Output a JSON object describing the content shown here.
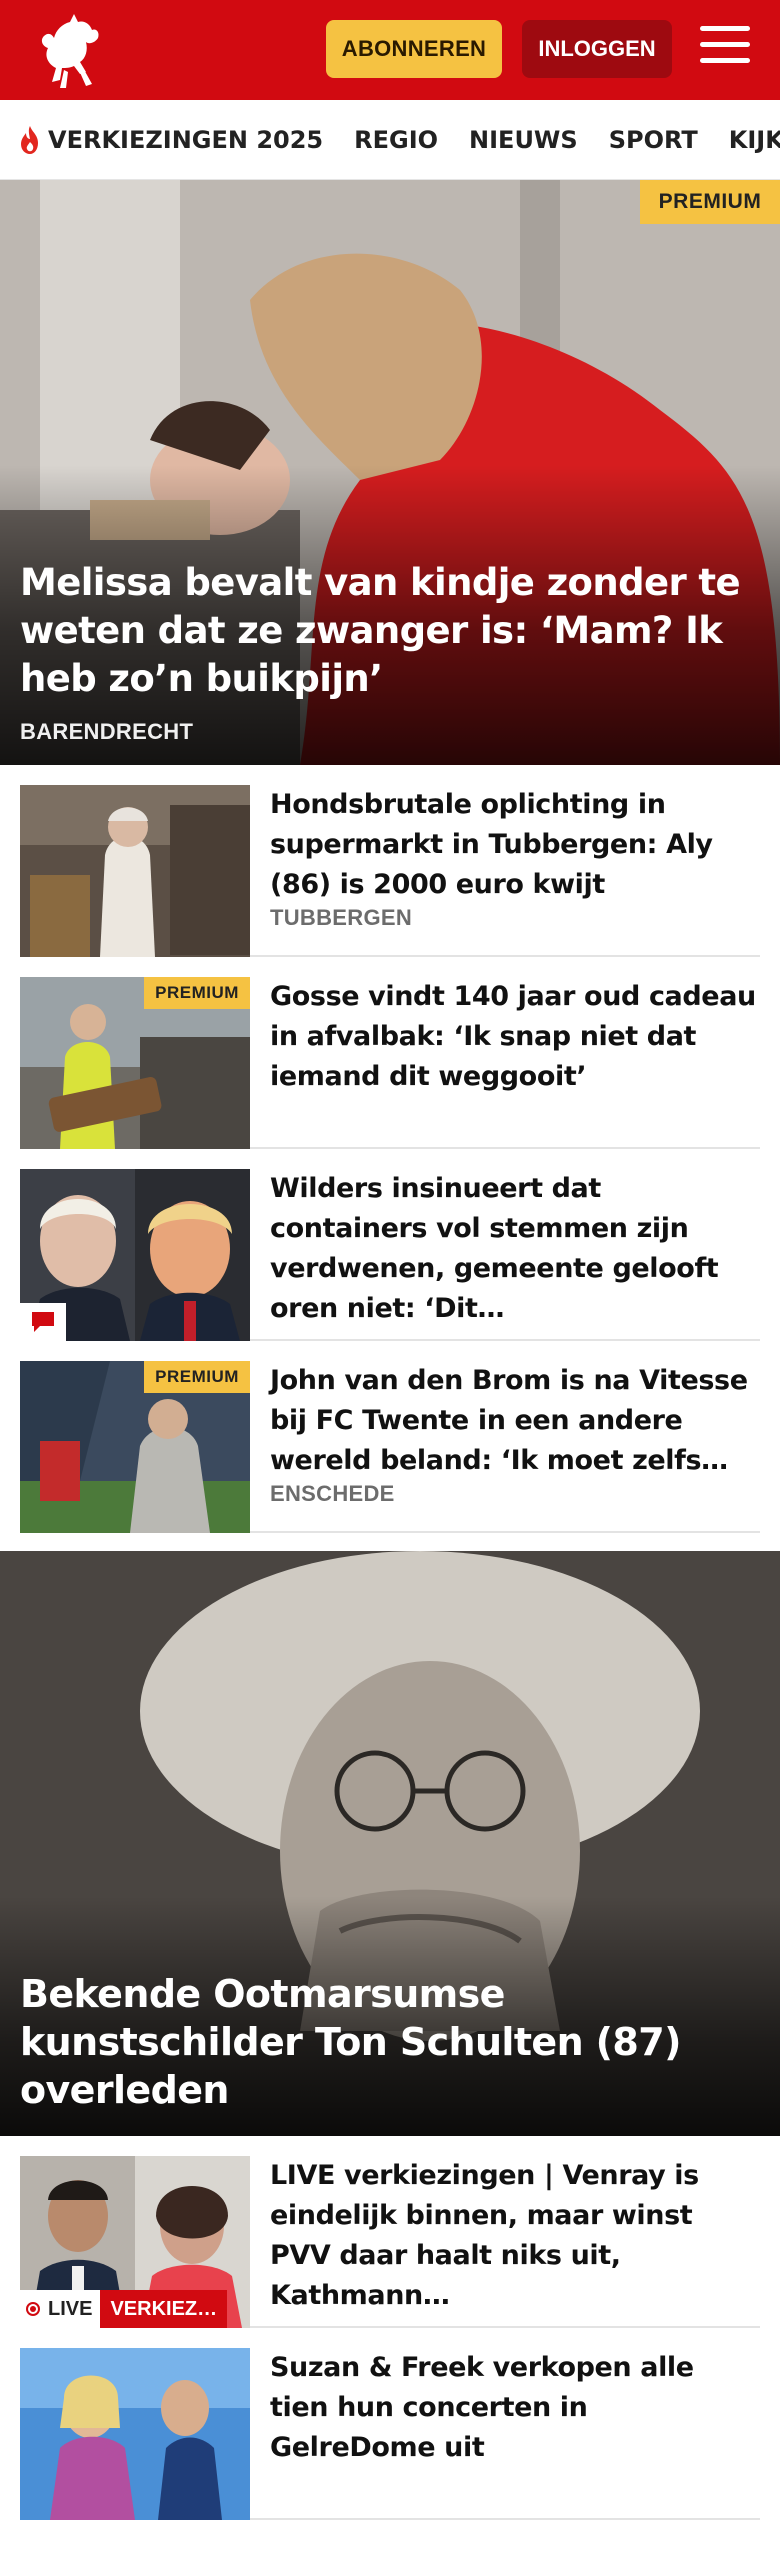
{
  "header": {
    "subscribe_label": "ABONNEREN",
    "login_label": "INLOGGEN"
  },
  "nav": {
    "items": [
      {
        "label": "VERKIEZINGEN 2025",
        "icon": "flame-icon"
      },
      {
        "label": "REGIO"
      },
      {
        "label": "NIEUWS"
      },
      {
        "label": "SPORT"
      },
      {
        "label": "KIJK"
      }
    ]
  },
  "hero": {
    "badge": "PREMIUM",
    "title": "Melissa bevalt van kindje zonder te weten dat ze zwanger is: ‘Mam? Ik heb zo’n buikpijn’",
    "location": "BARENDRECHT"
  },
  "articles": [
    {
      "title": "Hondsbrutale oplichting in supermarkt in Tubbergen: Aly (86) is 2000 euro kwijt",
      "location": "TUBBERGEN"
    },
    {
      "badge": "PREMIUM",
      "title": "Gosse vindt 140 jaar oud cadeau in afvalbak: ‘Ik snap niet dat iemand dit weggooit’"
    },
    {
      "title": "Wilders insinueert dat containers vol stemmen zijn verdwenen, gemeente gelooft oren niet: ‘Dit…",
      "icon": "comment-icon"
    },
    {
      "badge": "PREMIUM",
      "title": "John van den Brom is na Vitesse bij FC Twente in een andere wereld beland: ‘Ik moet zelfs…",
      "location": "ENSCHEDE"
    }
  ],
  "feature": {
    "title": "Bekende Ootmarsumse kunstschilder Ton Schulten (87) overleden"
  },
  "articles2": [
    {
      "title": "LIVE verkiezingen | Venray is eindelijk binnen, maar winst PVV daar haalt niks uit, Kathmann…",
      "live_label": "LIVE",
      "tag_label": "VERKIEZ…"
    },
    {
      "title": "Suzan & Freek verkopen alle tien hun concerten in GelreDome uit"
    }
  ],
  "colors": {
    "brand_red": "#d10a11",
    "premium_yellow": "#f5c242",
    "login_dark_red": "#9e0a10"
  }
}
